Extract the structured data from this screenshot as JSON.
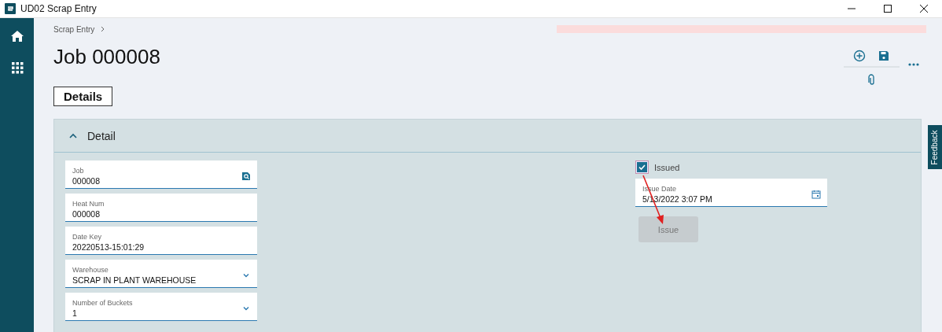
{
  "window": {
    "title": "UD02 Scrap Entry"
  },
  "breadcrumb": "Scrap Entry",
  "page_title": "Job 000008",
  "tabs": [
    {
      "label": "Details",
      "selected": true
    }
  ],
  "panel": {
    "title": "Detail",
    "expanded": true
  },
  "fields": [
    {
      "label": "Job",
      "value": "000008",
      "kind": "lookup"
    },
    {
      "label": "Heat Num",
      "value": "000008",
      "kind": "text"
    },
    {
      "label": "Date Key",
      "value": "20220513-15:01:29",
      "kind": "text"
    },
    {
      "label": "Warehouse",
      "value": "SCRAP IN PLANT WAREHOUSE",
      "kind": "dropdown"
    },
    {
      "label": "Number of Buckets",
      "value": "1",
      "kind": "dropdown"
    }
  ],
  "issued": {
    "label": "Issued",
    "checked": true
  },
  "issue_date": {
    "label": "Issue Date",
    "value": "5/13/2022 3:07 PM"
  },
  "issue_button": {
    "label": "Issue",
    "disabled": true
  },
  "feedback": "Feedback"
}
